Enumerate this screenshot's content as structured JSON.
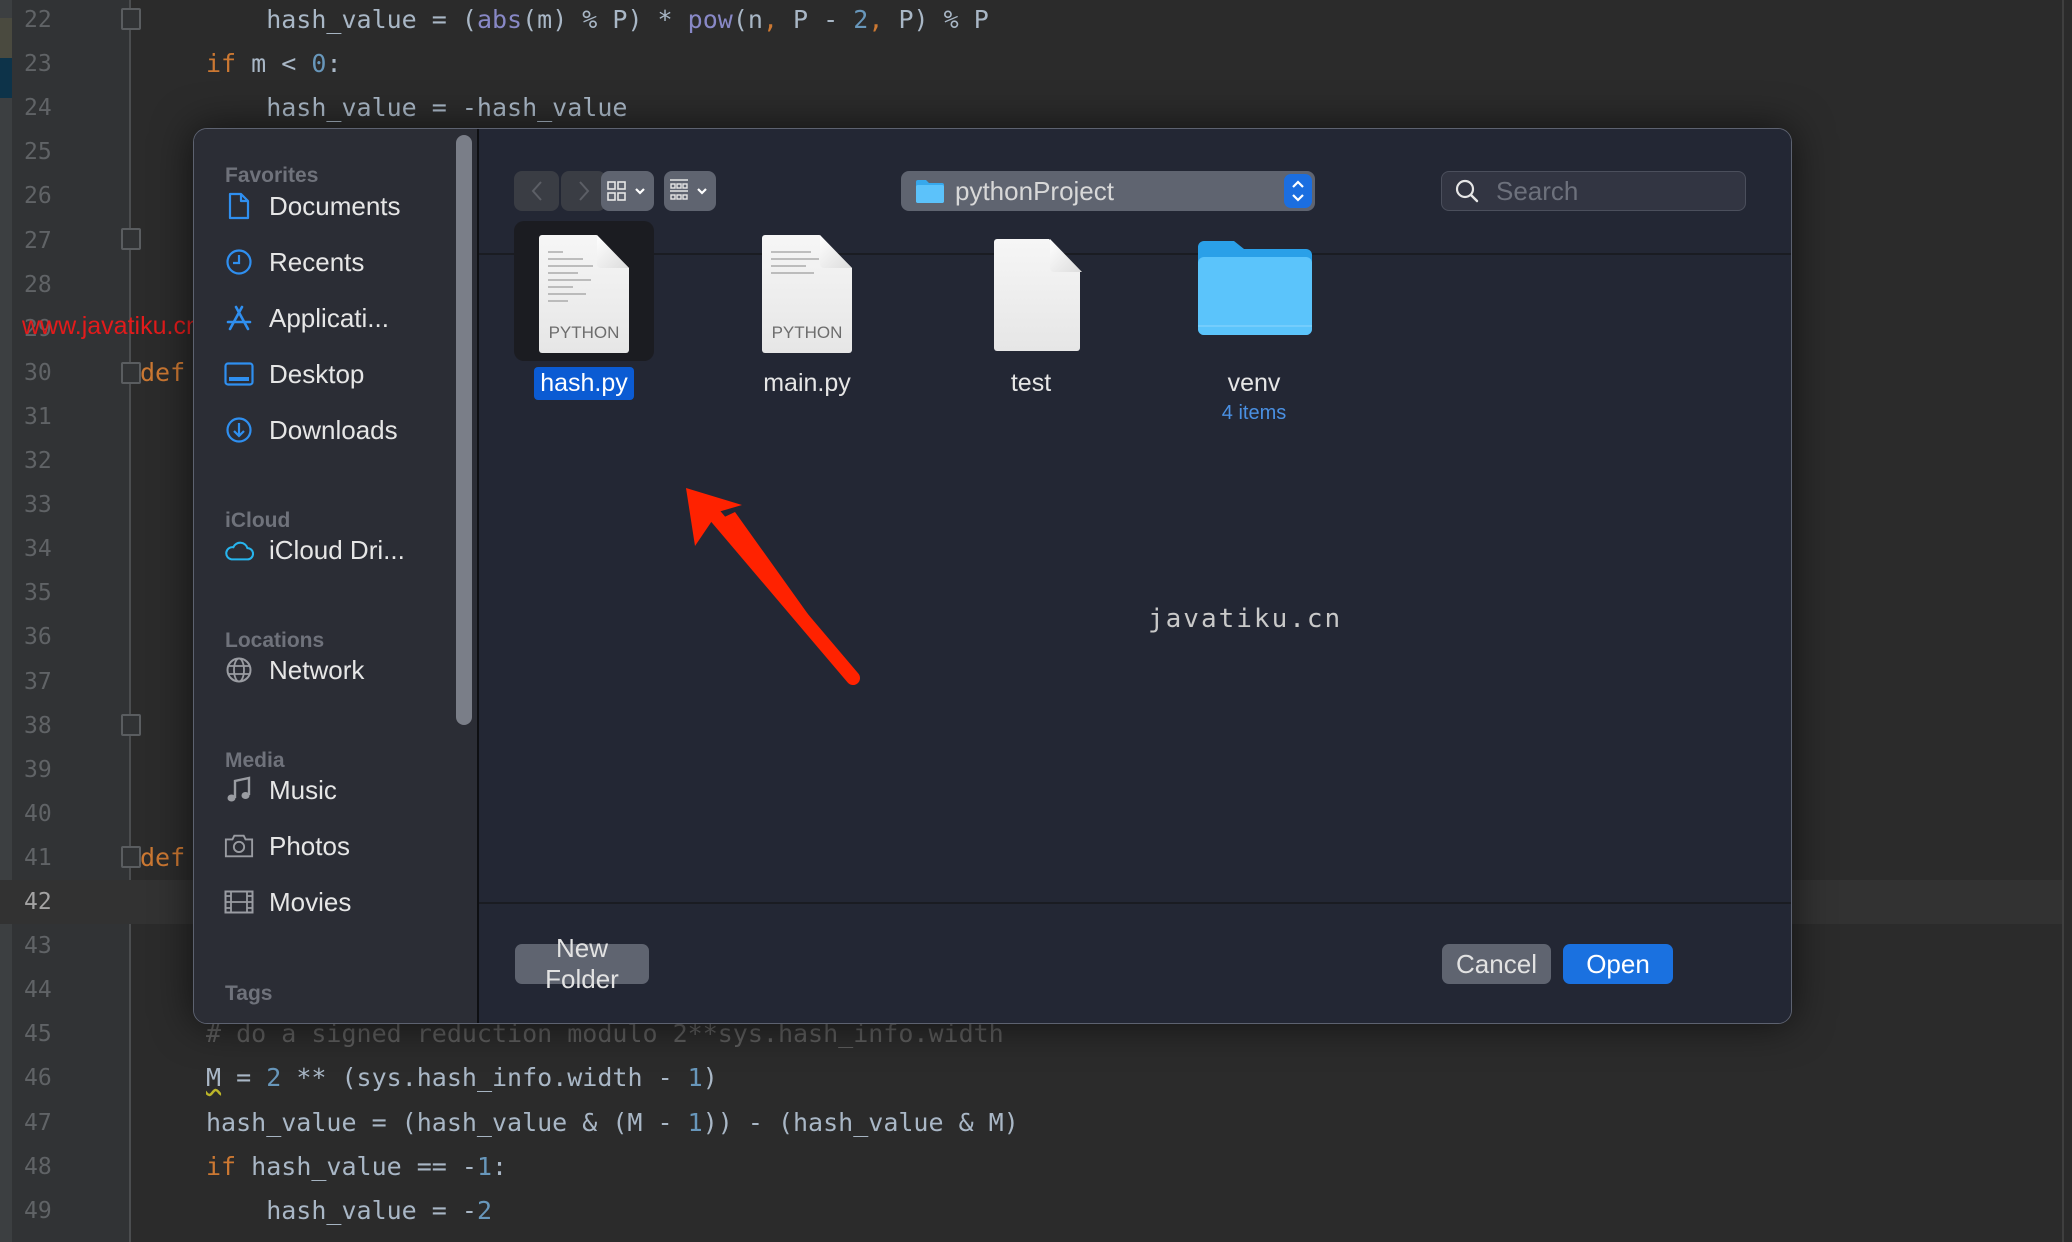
{
  "editor": {
    "lines": [
      {
        "n": "22",
        "segments": [
          [
            "",
            "    hash_value = ("
          ],
          [
            "bi",
            "abs"
          ],
          [
            "",
            "(m) % P) * "
          ],
          [
            "bi",
            "pow"
          ],
          [
            "",
            "(n"
          ],
          [
            "kw",
            ","
          ],
          [
            "",
            " P - "
          ],
          [
            "num",
            "2"
          ],
          [
            "kw",
            ","
          ],
          [
            "",
            " P) % P"
          ]
        ]
      },
      {
        "n": "23",
        "segments": [
          [
            "kw",
            "if"
          ],
          [
            "",
            " m < "
          ],
          [
            "num",
            "0"
          ],
          [
            "",
            ":"
          ]
        ]
      },
      {
        "n": "24",
        "segments": [
          [
            "",
            "    hash_value = -hash_value"
          ]
        ]
      },
      {
        "n": "25",
        "segments": []
      },
      {
        "n": "26",
        "segments": []
      },
      {
        "n": "27",
        "segments": []
      },
      {
        "n": "28",
        "segments": []
      },
      {
        "n": "29",
        "segments": []
      },
      {
        "n": "30",
        "segments": [
          [
            "kw",
            "def"
          ]
        ]
      },
      {
        "n": "31",
        "segments": []
      },
      {
        "n": "32",
        "segments": []
      },
      {
        "n": "33",
        "segments": []
      },
      {
        "n": "34",
        "segments": []
      },
      {
        "n": "35",
        "segments": []
      },
      {
        "n": "36",
        "segments": []
      },
      {
        "n": "37",
        "segments": []
      },
      {
        "n": "38",
        "segments": []
      },
      {
        "n": "39",
        "segments": []
      },
      {
        "n": "40",
        "segments": []
      },
      {
        "n": "41",
        "segments": [
          [
            "kw",
            "def"
          ]
        ]
      },
      {
        "n": "42",
        "segments": [],
        "current": true
      },
      {
        "n": "43",
        "segments": []
      },
      {
        "n": "44",
        "segments": []
      },
      {
        "n": "45",
        "segments": [
          [
            "cm",
            "# do a signed reduction modulo 2**sys.hash_info.width"
          ]
        ]
      },
      {
        "n": "46",
        "segments": [
          [
            "warn",
            "M"
          ],
          [
            "",
            " = "
          ],
          [
            "num",
            "2"
          ],
          [
            "",
            " ** (sys.hash_info.width - "
          ],
          [
            "num",
            "1"
          ],
          [
            "",
            ")"
          ]
        ]
      },
      {
        "n": "47",
        "segments": [
          [
            "",
            "hash_value = (hash_value & (M - "
          ],
          [
            "num",
            "1"
          ],
          [
            "",
            ")) - (hash_value & M)"
          ]
        ]
      },
      {
        "n": "48",
        "segments": [
          [
            "kw",
            "if"
          ],
          [
            "",
            " hash_value == -"
          ],
          [
            "num",
            "1"
          ],
          [
            "",
            ":"
          ]
        ]
      },
      {
        "n": "49",
        "segments": [
          [
            "",
            "    hash_value = -"
          ],
          [
            "num",
            "2"
          ]
        ]
      }
    ],
    "watermark": "www.javatiku.cn"
  },
  "dialog": {
    "sidebar": {
      "sections": [
        {
          "title": "Favorites",
          "items": [
            {
              "label": "Documents",
              "icon": "document-icon"
            },
            {
              "label": "Recents",
              "icon": "clock-icon"
            },
            {
              "label": "Applicati...",
              "icon": "applications-icon"
            },
            {
              "label": "Desktop",
              "icon": "desktop-icon"
            },
            {
              "label": "Downloads",
              "icon": "download-icon"
            }
          ]
        },
        {
          "title": "iCloud",
          "items": [
            {
              "label": "iCloud Dri...",
              "icon": "cloud-icon"
            }
          ]
        },
        {
          "title": "Locations",
          "items": [
            {
              "label": "Network",
              "icon": "globe-icon"
            }
          ]
        },
        {
          "title": "Media",
          "items": [
            {
              "label": "Music",
              "icon": "music-note-icon"
            },
            {
              "label": "Photos",
              "icon": "camera-icon"
            },
            {
              "label": "Movies",
              "icon": "film-icon"
            }
          ]
        },
        {
          "title": "Tags",
          "items": []
        }
      ]
    },
    "toolbar": {
      "current_folder": "pythonProject",
      "search_placeholder": "Search",
      "search_value": ""
    },
    "files": [
      {
        "name": "hash.py",
        "type_label": "PYTHON",
        "kind": "python",
        "selected": true
      },
      {
        "name": "main.py",
        "type_label": "PYTHON",
        "kind": "python",
        "selected": false
      },
      {
        "name": "test",
        "type_label": "",
        "kind": "blank",
        "selected": false
      },
      {
        "name": "venv",
        "subtitle": "4 items",
        "kind": "folder",
        "selected": false
      }
    ],
    "watermark": "javatiku.cn",
    "buttons": {
      "new_folder": "New Folder",
      "cancel": "Cancel",
      "open": "Open"
    },
    "colors": {
      "accent": "#1a71e0",
      "selection": "#0b5bd3",
      "sidebar_icon": "#2f8ff0",
      "annotation_arrow": "#ff2200"
    }
  }
}
